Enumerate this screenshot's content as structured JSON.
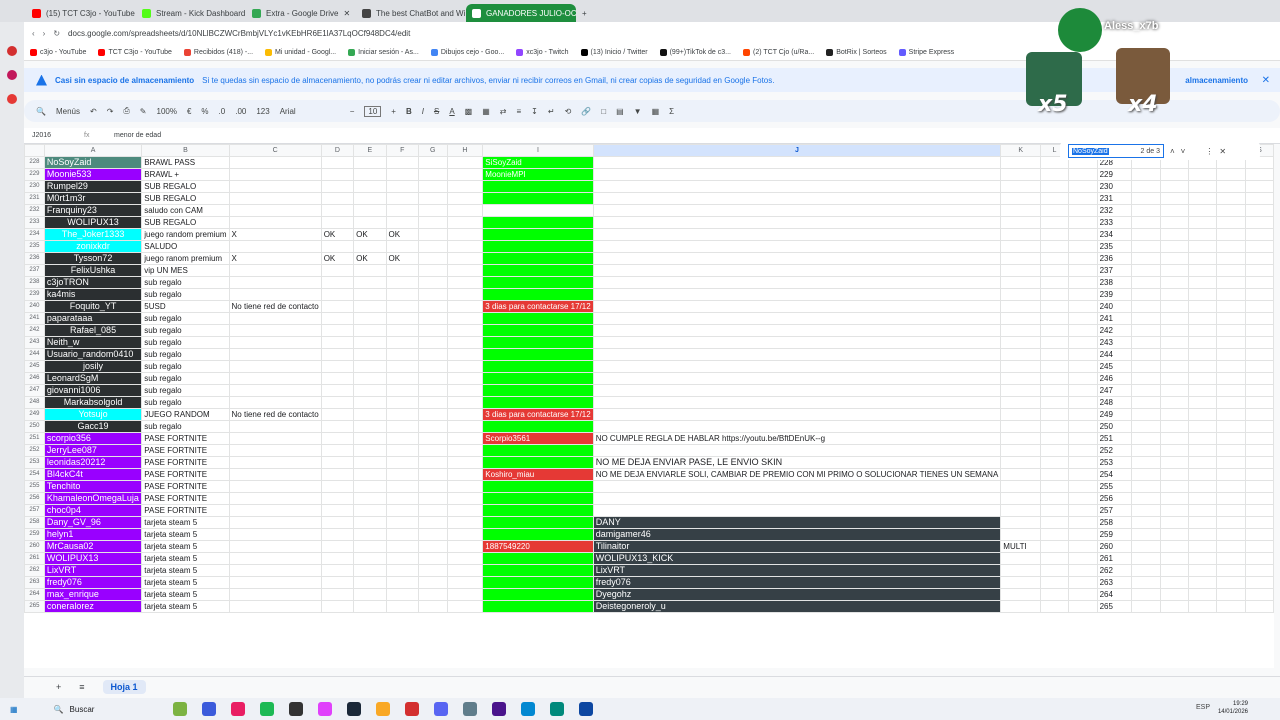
{
  "tabs": [
    {
      "label": "(15) TCT C3jo - YouTube",
      "color": "#ff0000"
    },
    {
      "label": "Stream - Kick Dashboard",
      "color": "#53fc18"
    },
    {
      "label": "Extra - Google Drive",
      "color": "#34a853"
    },
    {
      "label": "The best ChatBot and Wi",
      "color": "#444444"
    },
    {
      "label": "GANADORES JULIO-OCT",
      "color": "#ffffff",
      "active": true
    }
  ],
  "address": {
    "url": "docs.google.com/spreadsheets/d/10NLlBCZWCrBmbjVLYc1vKEbHR6E1lA37LqOCf948DC4/edit"
  },
  "bookmarks": [
    {
      "label": "c3jo - YouTube",
      "color": "#ff0000"
    },
    {
      "label": "TCT C3jo - YouTube",
      "color": "#ff0000"
    },
    {
      "label": "Recibidos (418) -...",
      "color": "#ea4335"
    },
    {
      "label": "Mi unidad - Googl...",
      "color": "#fbbc04"
    },
    {
      "label": "Iniciar sesión - As...",
      "color": "#34a853"
    },
    {
      "label": "Dibujos cejo - Goo...",
      "color": "#4285f4"
    },
    {
      "label": "xc3jo - Twitch",
      "color": "#9146ff"
    },
    {
      "label": "(13) Inicio / Twitter",
      "color": "#000000"
    },
    {
      "label": "(99+)TikTok de c3...",
      "color": "#111111"
    },
    {
      "label": "(2) TCT Cjo (u/Ra...",
      "color": "#ff4500"
    },
    {
      "label": "BotRix | Sorteos",
      "color": "#222222"
    },
    {
      "label": "Stripe Express",
      "color": "#635bff"
    }
  ],
  "banner": {
    "title": "Casi sin espacio de almacenamiento",
    "message": "Si te quedas sin espacio de almacenamiento, no podrás crear ni editar archivos, enviar ni recibir correos en Gmail, ni crear copias de seguridad en Google Fotos.",
    "action": "almacenamiento"
  },
  "toolbar": {
    "menus": "Menús",
    "zoom": "100%",
    "currency": "€",
    "percent": "%",
    "dec_less": ".0",
    "dec_more": ".00",
    "format": "123",
    "font": "Arial",
    "font_size": "10",
    "sum": "Σ"
  },
  "formula": {
    "cell": "J2016",
    "value": "menor de edad"
  },
  "find": {
    "query": "NoSoyZaid",
    "count": "2 de 3"
  },
  "overlay": {
    "user": "Aless_x7b",
    "mult1": "x5",
    "mult2": "x4"
  },
  "columns": [
    "A",
    "B",
    "C",
    "D",
    "E",
    "F",
    "G",
    "H",
    "I",
    "J",
    "K",
    "L",
    "M",
    "N",
    "O",
    "P",
    "Q",
    "R",
    "S"
  ],
  "rows": [
    {
      "n": "228",
      "a": "NoSoyZaid",
      "ac": "bgteal",
      "b": "BRAWL PASS",
      "i": "SiSoyZaid",
      "ic": "bggreen"
    },
    {
      "n": "229",
      "a": "Moonie533",
      "ac": "bgpurple",
      "b": "BRAWL +",
      "i": "MoonieMPI",
      "ic": "bggreen"
    },
    {
      "n": "230",
      "a": "Rumpel29",
      "ac": "bgdark",
      "b": "SUB REGALO",
      "ic": "bggreen"
    },
    {
      "n": "231",
      "a": "M0rt1m3r",
      "ac": "bgdark",
      "b": "SUB REGALO",
      "ic": "bggreen"
    },
    {
      "n": "232",
      "a": "Franquiny23",
      "ac": "bgdark",
      "b": "saludo con CAM",
      "ic": ""
    },
    {
      "n": "233",
      "a": "WOLIPUX13",
      "ac": "bgdark",
      "acenter": true,
      "b": "SUB REGALO",
      "ic": "bggreen"
    },
    {
      "n": "234",
      "a": "The_Joker1333",
      "ac": "bgcyan",
      "acenter": true,
      "b": "juego random premium",
      "c": "X",
      "d": "OK",
      "e": "OK",
      "f": "OK",
      "ic": "bggreen"
    },
    {
      "n": "235",
      "a": "zonixkdr",
      "ac": "bgcyan",
      "acenter": true,
      "b": "SALUDO",
      "ic": "bggreen"
    },
    {
      "n": "236",
      "a": "Tysson72",
      "ac": "bgdark",
      "acenter": true,
      "b": "juego ranom premium",
      "c": "X",
      "d": "OK",
      "e": "OK",
      "f": "OK",
      "ic": "bggreen"
    },
    {
      "n": "237",
      "a": "FelixUshka",
      "ac": "bgdark",
      "acenter": true,
      "b": "vip UN MES",
      "ic": "bggreen"
    },
    {
      "n": "238",
      "a": "c3joTRON",
      "ac": "bgdark",
      "b": "sub regalo",
      "ic": "bggreen"
    },
    {
      "n": "239",
      "a": "ka4mis",
      "ac": "bgdark",
      "b": "sub regalo",
      "ic": "bggreen"
    },
    {
      "n": "240",
      "a": "Foquito_YT",
      "ac": "bgdark",
      "acenter": true,
      "b": "5USD",
      "c": "No tiene red de contacto",
      "i": "3 dias para contactarse 17/12",
      "ic": "bgred"
    },
    {
      "n": "241",
      "a": "paparataaa",
      "ac": "bgdark",
      "b": "sub regalo",
      "ic": "bggreen"
    },
    {
      "n": "242",
      "a": "Rafael_085",
      "ac": "bgdark",
      "acenter": true,
      "b": "sub regalo",
      "ic": "bggreen"
    },
    {
      "n": "243",
      "a": "Neith_w",
      "ac": "bgdark",
      "b": "sub regalo",
      "ic": "bggreen"
    },
    {
      "n": "244",
      "a": "Usuario_random0410",
      "ac": "bgdark",
      "b": "sub regalo",
      "ic": "bggreen"
    },
    {
      "n": "245",
      "a": "josily",
      "ac": "bgdark",
      "acenter": true,
      "b": "sub regalo",
      "ic": "bggreen"
    },
    {
      "n": "246",
      "a": "LeonardSgM",
      "ac": "bgdark",
      "b": "sub regalo",
      "ic": "bggreen"
    },
    {
      "n": "247",
      "a": "giovanni1006",
      "ac": "bgdark",
      "b": "sub regalo",
      "ic": "bggreen"
    },
    {
      "n": "248",
      "a": "Markabsolgold",
      "ac": "bgdark",
      "acenter": true,
      "b": "sub regalo",
      "ic": "bggreen"
    },
    {
      "n": "249",
      "a": "Yotsujo",
      "ac": "bgcyan",
      "acenter": true,
      "b": "JUEGO RANDOM",
      "c": "No tiene red de contacto",
      "i": "3 dias para contactarse 17/12",
      "ic": "bgred"
    },
    {
      "n": "250",
      "a": "Gacc19",
      "ac": "bgdark",
      "acenter": true,
      "b": "sub regalo",
      "ic": "bggreen"
    },
    {
      "n": "251",
      "a": "scorpio356",
      "ac": "bgpurple",
      "b": "PASE FORTNITE",
      "i": "Scorpio3561",
      "ic": "bgred",
      "j": "NO CUMPLE REGLA DE HABLAR https://youtu.be/BftDEnUK--g"
    },
    {
      "n": "252",
      "a": "JerryLee087",
      "ac": "bgpurple",
      "b": "PASE FORTNITE",
      "ic": "bggreen"
    },
    {
      "n": "253",
      "a": "leonidas20212",
      "ac": "bgpurple",
      "b": "PASE FORTNITE",
      "ic": "bggreen",
      "j": "NO ME DEJA ENVIAR PASE, LE ENVIO SKIN",
      "jbig": true
    },
    {
      "n": "254",
      "a": "Bl4ckC4t",
      "ac": "bgpurple",
      "b": "PASE FORTNITE",
      "i": "Koshiro_miau",
      "ic": "bgred",
      "j": "NO ME DEJA ENVIARLE SOLI, CAMBIAR DE PREMIO CON MI PRIMO O SOLUCIONAR TIENES UN SEMANA"
    },
    {
      "n": "255",
      "a": "Tenchito",
      "ac": "bgpurple",
      "b": "PASE FORTNITE",
      "ic": "bggreen"
    },
    {
      "n": "256",
      "a": "KhamaleonOmegaLuja",
      "ac": "bgpurple",
      "b": "PASE FORTNITE",
      "ic": "bggreen"
    },
    {
      "n": "257",
      "a": "choc0p4",
      "ac": "bgpurple",
      "b": "PASE FORTNITE",
      "ic": "bggreen"
    },
    {
      "n": "258",
      "a": "Dany_GV_96",
      "ac": "bgpurple",
      "b": "tarjeta steam 5",
      "ic": "bggreen",
      "j": "DANY",
      "jdark": true
    },
    {
      "n": "259",
      "a": "helyn1",
      "ac": "bgpurple",
      "b": "tarjeta steam 5",
      "ic": "bggreen",
      "j": "damigamer46",
      "jdark": true
    },
    {
      "n": "260",
      "a": "MrCausa02",
      "ac": "bgpurple",
      "b": "tarjeta steam 5",
      "i": "1887549220",
      "ic": "bgred",
      "j": "Tilinaitor",
      "jdark": true,
      "k": "MULTI"
    },
    {
      "n": "261",
      "a": "WOLIPUX13",
      "ac": "bgpurple",
      "b": "tarjeta steam 5",
      "ic": "bggreen",
      "j": "WOLIPUX13_KICK",
      "jdark": true
    },
    {
      "n": "262",
      "a": "LixVRT",
      "ac": "bgpurple",
      "b": "tarjeta steam 5",
      "ic": "bggreen",
      "j": "LixVRT",
      "jdark": true
    },
    {
      "n": "263",
      "a": "fredy076",
      "ac": "bgpurple",
      "b": "tarjeta steam 5",
      "ic": "bggreen",
      "j": "fredy076",
      "jdark": true
    },
    {
      "n": "264",
      "a": "max_enrique",
      "ac": "bgpurple",
      "b": "tarjeta steam 5",
      "ic": "bggreen",
      "j": "Dyegohz",
      "jdark": true
    },
    {
      "n": "265",
      "a": "coneralorez",
      "ac": "bgpurple",
      "b": "tarjeta steam 5",
      "ic": "bggreen",
      "j": "Deistegoneroly_u",
      "jdark": true
    }
  ],
  "sheet": {
    "add": "+",
    "list": "≡",
    "tab": "Hoja 1"
  },
  "taskbar": {
    "search": "Buscar",
    "lang": "ESP",
    "time": "19:29",
    "date": "14/01/2026"
  }
}
